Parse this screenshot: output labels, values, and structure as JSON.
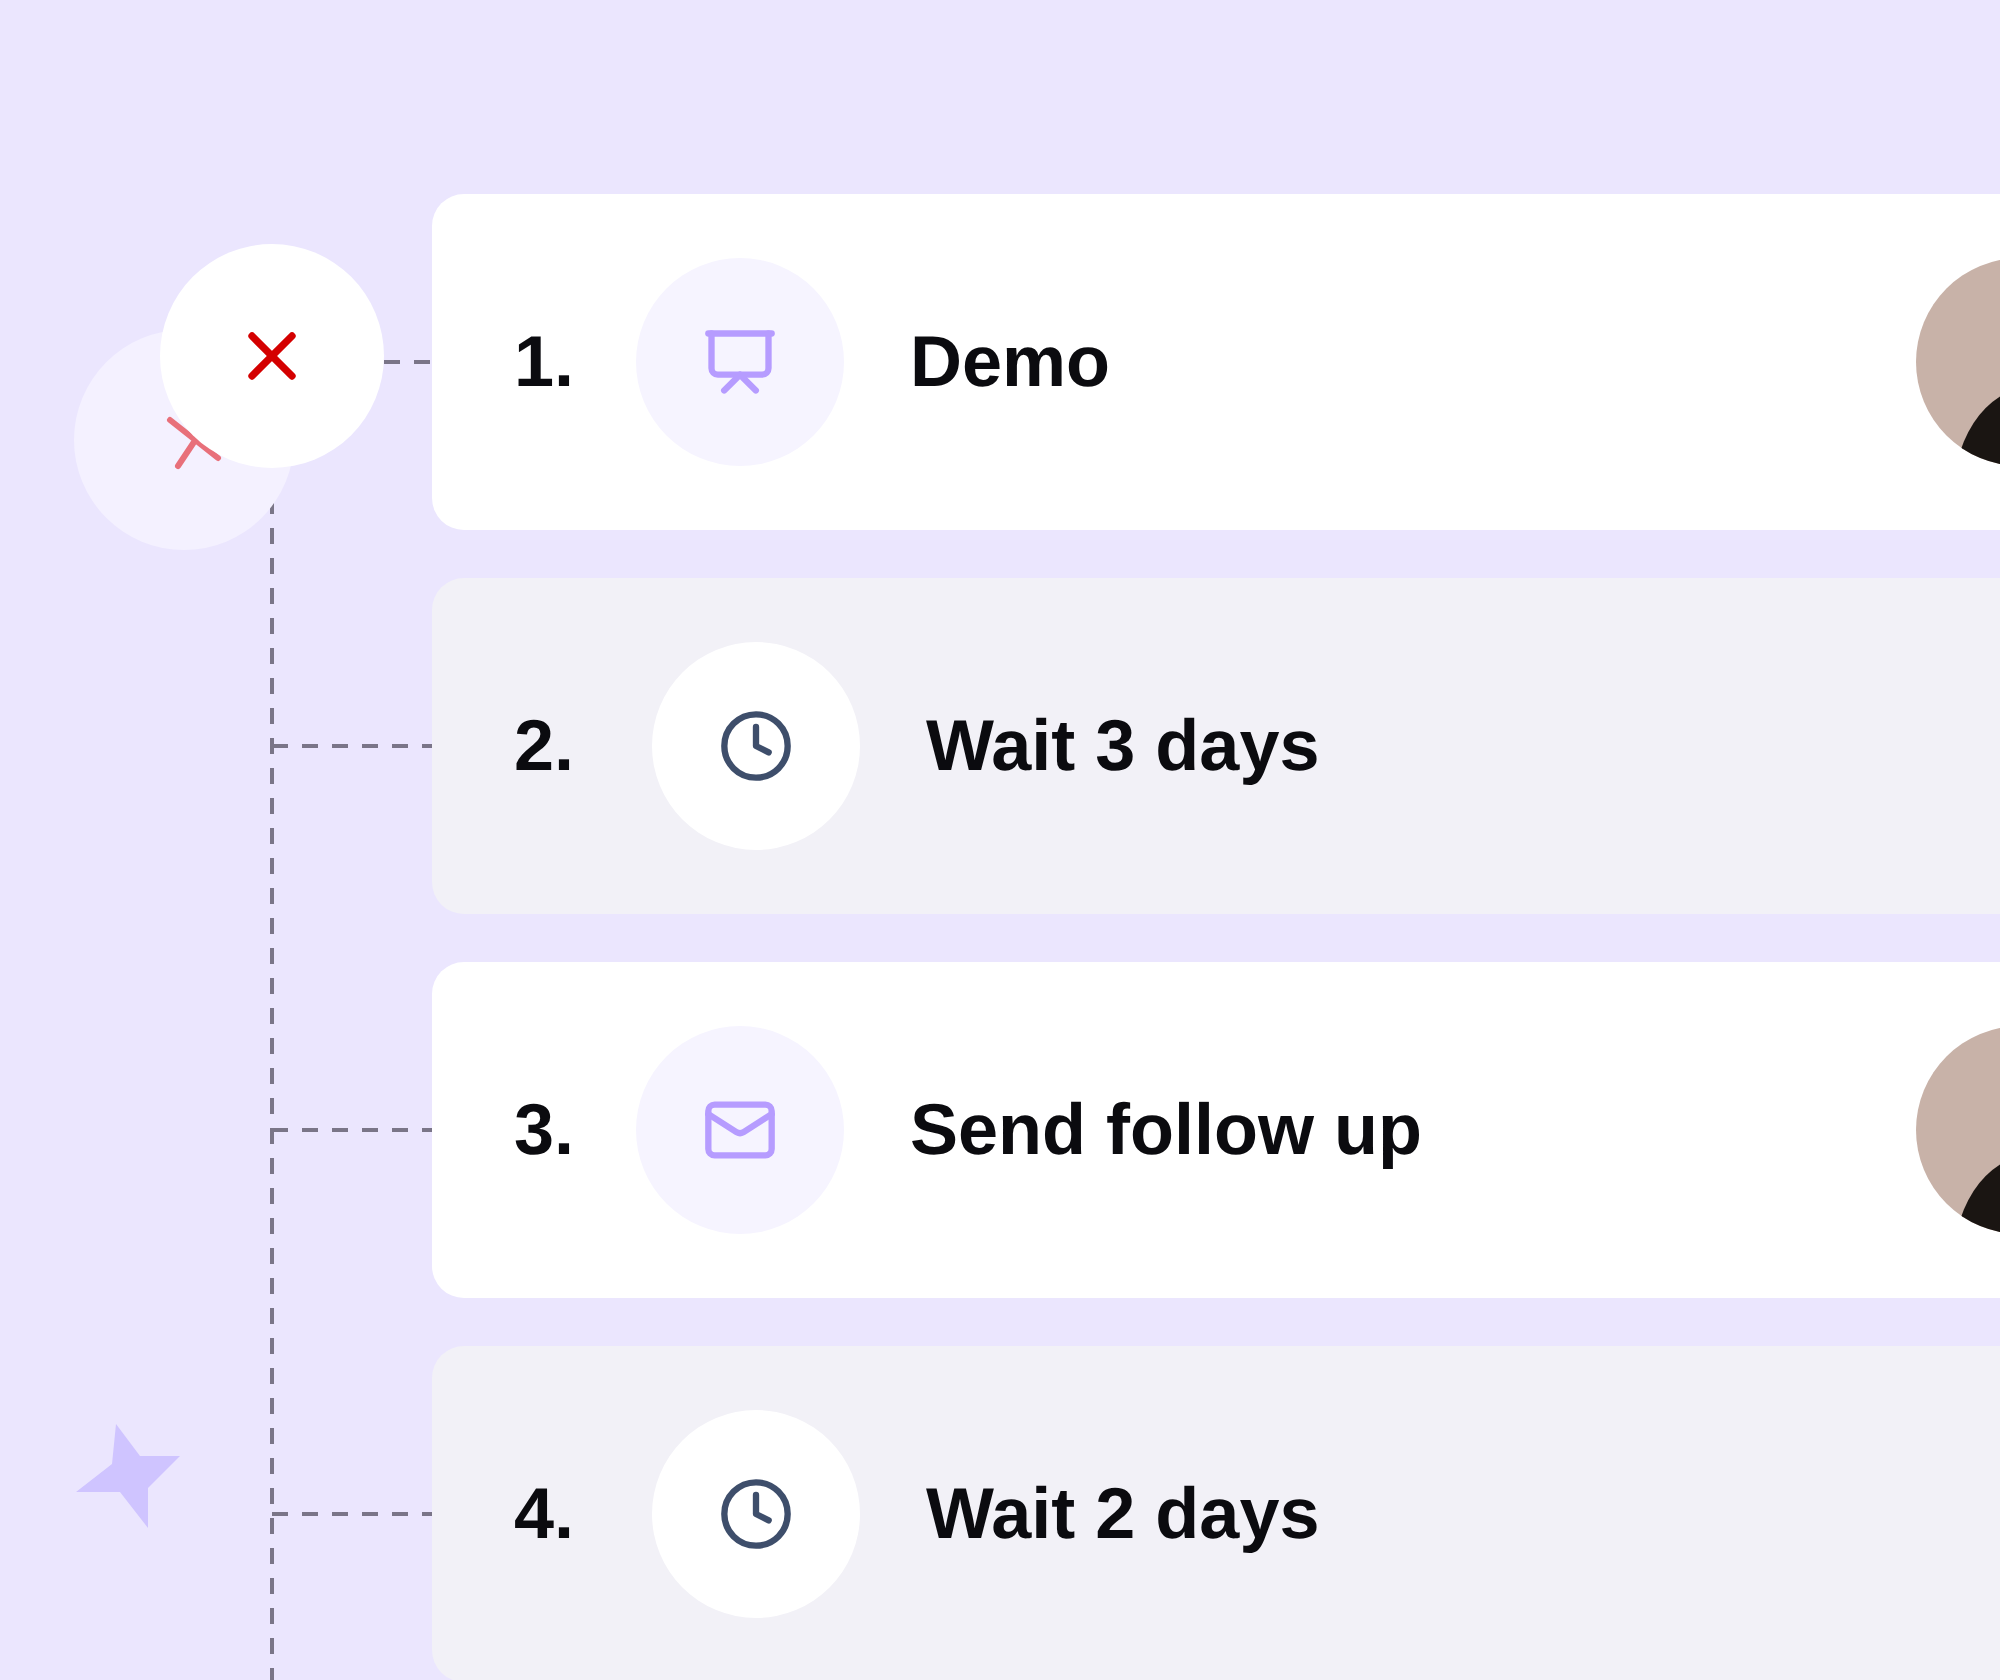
{
  "steps": [
    {
      "number": "1.",
      "title": "Demo",
      "kind": "presentation",
      "avatar": true
    },
    {
      "number": "2.",
      "title": "Wait 3 days",
      "kind": "wait",
      "avatar": false
    },
    {
      "number": "3.",
      "title": "Send follow up",
      "kind": "email",
      "avatar": true
    },
    {
      "number": "4.",
      "title": "Wait 2 days",
      "kind": "wait",
      "avatar": false
    }
  ]
}
